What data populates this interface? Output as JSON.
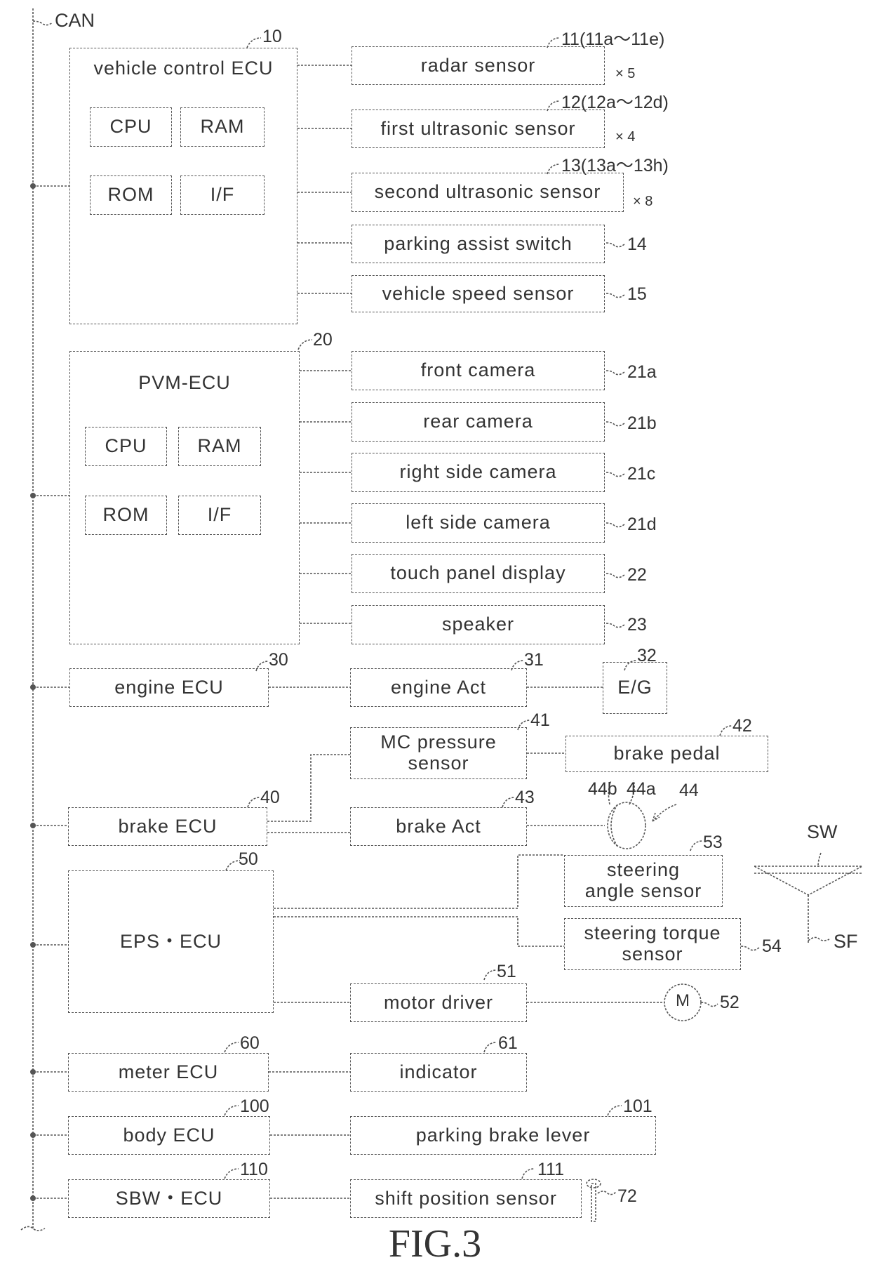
{
  "figure_label": "FIG.3",
  "bus_label": "CAN",
  "vehicle_control_ecu": {
    "title": "vehicle control ECU",
    "ref": "10",
    "parts": [
      "CPU",
      "RAM",
      "ROM",
      "I/F"
    ]
  },
  "vc_peripherals": [
    {
      "label": "radar sensor",
      "ref": "11(11a〜11e)",
      "mult": "× 5"
    },
    {
      "label": "first ultrasonic sensor",
      "ref": "12(12a〜12d)",
      "mult": "× 4"
    },
    {
      "label": "second ultrasonic sensor",
      "ref": "13(13a〜13h)",
      "mult": "× 8"
    },
    {
      "label": "parking assist switch",
      "ref": "14"
    },
    {
      "label": "vehicle speed sensor",
      "ref": "15"
    }
  ],
  "pvm_ecu": {
    "title": "PVM-ECU",
    "ref": "20",
    "parts": [
      "CPU",
      "RAM",
      "ROM",
      "I/F"
    ]
  },
  "pvm_peripherals": [
    {
      "label": "front camera",
      "ref": "21a"
    },
    {
      "label": "rear camera",
      "ref": "21b"
    },
    {
      "label": "right side camera",
      "ref": "21c"
    },
    {
      "label": "left side camera",
      "ref": "21d"
    },
    {
      "label": "touch panel display",
      "ref": "22"
    },
    {
      "label": "speaker",
      "ref": "23"
    }
  ],
  "engine": {
    "ecu": {
      "label": "engine ECU",
      "ref": "30"
    },
    "act": {
      "label": "engine Act",
      "ref": "31"
    },
    "eg": {
      "label": "E/G",
      "ref": "32"
    }
  },
  "brake": {
    "ecu": {
      "label": "brake ECU",
      "ref": "40"
    },
    "mc": {
      "label": "MC pressure sensor",
      "line1": "MC pressure",
      "line2": "sensor",
      "ref": "41"
    },
    "pedal": {
      "label": "brake pedal",
      "ref": "42"
    },
    "act": {
      "label": "brake Act",
      "ref": "43"
    },
    "wheel_refs": {
      "b": "44b",
      "a": "44a",
      "group": "44"
    }
  },
  "eps": {
    "ecu": {
      "label": "EPS・ECU",
      "ref": "50"
    },
    "motor_driver": {
      "label": "motor driver",
      "ref": "51"
    },
    "motor": {
      "label": "M",
      "ref": "52"
    },
    "angle_sensor": {
      "line1": "steering",
      "line2": "angle sensor",
      "ref": "53"
    },
    "torque_sensor": {
      "line1": "steering torque",
      "line2": "sensor",
      "ref": "54"
    },
    "steering_wheel": "SW",
    "steering_shaft": "SF"
  },
  "meter": {
    "ecu": {
      "label": "meter ECU",
      "ref": "60"
    },
    "indicator": {
      "label": "indicator",
      "ref": "61"
    }
  },
  "body": {
    "ecu": {
      "label": "body ECU",
      "ref": "100"
    },
    "lever": {
      "label": "parking brake lever",
      "ref": "101"
    }
  },
  "sbw": {
    "ecu": {
      "label": "SBW・ECU",
      "ref": "110"
    },
    "shift": {
      "label": "shift position sensor",
      "ref": "111"
    },
    "shifter_ref": "72"
  }
}
